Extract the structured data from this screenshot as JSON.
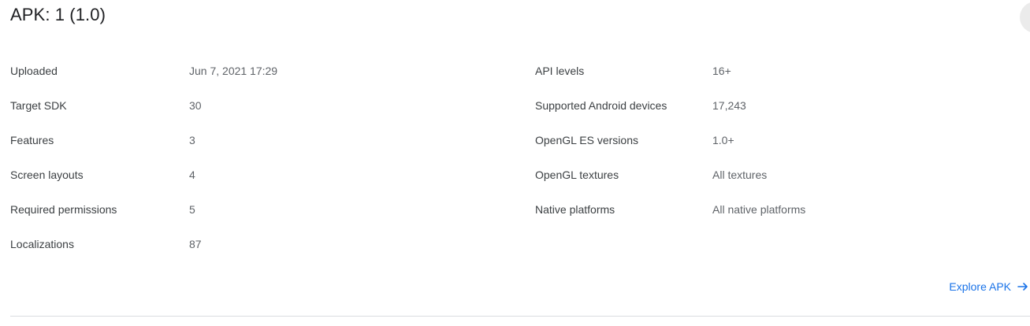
{
  "header": {
    "title": "APK: 1 (1.0)"
  },
  "details_left": [
    {
      "label": "Uploaded",
      "value": "Jun 7, 2021 17:29"
    },
    {
      "label": "Target SDK",
      "value": "30"
    },
    {
      "label": "Features",
      "value": "3"
    },
    {
      "label": "Screen layouts",
      "value": "4"
    },
    {
      "label": "Required permissions",
      "value": "5"
    },
    {
      "label": "Localizations",
      "value": "87"
    }
  ],
  "details_right": [
    {
      "label": "API levels",
      "value": "16+"
    },
    {
      "label": "Supported Android devices",
      "value": "17,243"
    },
    {
      "label": "OpenGL ES versions",
      "value": "1.0+"
    },
    {
      "label": "OpenGL textures",
      "value": "All textures"
    },
    {
      "label": "Native platforms",
      "value": "All native platforms"
    }
  ],
  "actions": {
    "explore_label": "Explore APK",
    "explore_icon": "arrow-right-icon"
  },
  "colors": {
    "accent": "#1a73e8",
    "label": "#3c4043",
    "value": "#5f6368",
    "divider": "#dadce0"
  }
}
